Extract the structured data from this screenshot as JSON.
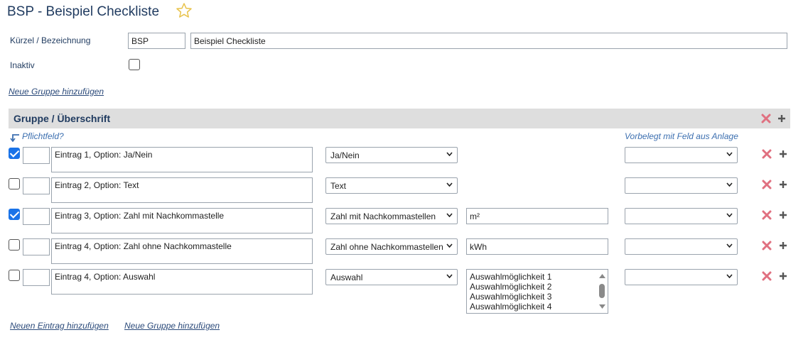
{
  "header": {
    "title": "BSP - Beispiel Checkliste"
  },
  "form": {
    "kuerzel_label": "Kürzel / Bezeichnung",
    "kuerzel_value": "BSP",
    "bezeichnung_value": "Beispiel Checkliste",
    "inaktiv_label": "Inaktiv",
    "inaktiv_checked": false,
    "add_group_top": "Neue Gruppe hinzufügen"
  },
  "group": {
    "title": "Gruppe / Überschrift",
    "hint_required": "Pflichtfeld?",
    "hint_prefill": "Vorbelegt mit Feld aus Anlage"
  },
  "entries": [
    {
      "checked": true,
      "text": "Eintrag 1, Option: Ja/Nein",
      "type": "Ja/Nein",
      "unit": null,
      "prefill": ""
    },
    {
      "checked": false,
      "text": "Eintrag 2, Option: Text",
      "type": "Text",
      "unit": null,
      "prefill": ""
    },
    {
      "checked": true,
      "text": "Eintrag 3, Option: Zahl mit Nachkommastelle",
      "type": "Zahl mit Nachkommastellen",
      "unit": "m²",
      "prefill": ""
    },
    {
      "checked": false,
      "text": "Eintrag 4, Option: Zahl ohne Nachkommastelle",
      "type": "Zahl ohne Nachkommastellen",
      "unit": "kWh",
      "prefill": ""
    },
    {
      "checked": false,
      "text": "Eintrag 4, Option: Auswahl",
      "type": "Auswahl",
      "options": [
        "Auswahlmöglichkeit 1",
        "Auswahlmöglichkeit 2",
        "Auswahlmöglichkeit 3",
        "Auswahlmöglichkeit 4"
      ],
      "prefill": ""
    }
  ],
  "footer": {
    "add_entry": "Neuen Eintrag hinzufügen",
    "add_group": "Neue Gruppe hinzufügen"
  },
  "colors": {
    "title": "#1f3a5f",
    "link": "#2b4a7a",
    "hint": "#3c6fb0",
    "group_bar": "#dedede",
    "delete_icon": "#e07080",
    "add_icon": "#555555",
    "checkbox_checked": "#1a73e8",
    "star": "#e8c24a"
  },
  "icons": {
    "favorite": "star-icon",
    "delete": "x-icon",
    "add": "plus-icon",
    "dropdown": "chevron-down-icon",
    "required_hint": "arrow-corner-icon"
  }
}
